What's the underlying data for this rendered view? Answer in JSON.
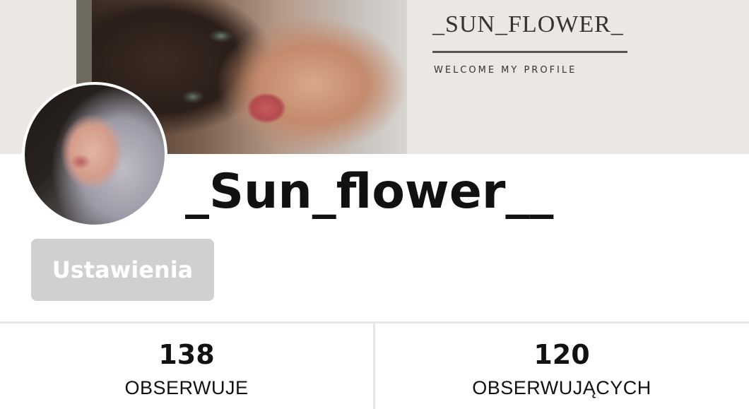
{
  "cover": {
    "title": "_SUN_FLOWER_",
    "subtitle": "WELCOME MY PROFILE"
  },
  "profile": {
    "username": "_Sun_flower__",
    "settings_label": "Ustawienia"
  },
  "stats": {
    "following": {
      "count": "138",
      "label": "OBSERWUJE"
    },
    "followers": {
      "count": "120",
      "label": "OBSERWUJĄCYCH"
    }
  },
  "colors": {
    "accent_line": "#2e8a6e",
    "button_bg": "#d0d0d0",
    "cover_bg": "#ebe7e2"
  }
}
